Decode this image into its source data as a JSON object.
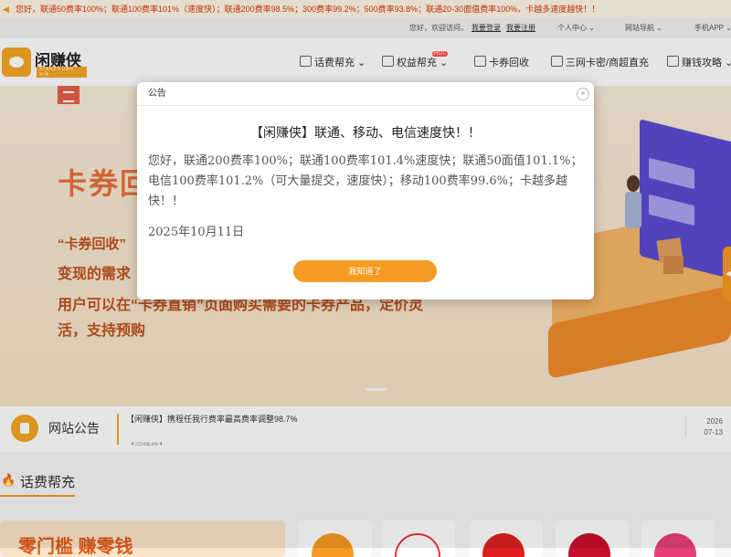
{
  "ticker": "您好，联通50费率100%；联通100费率101%（速度快）；联通200费率98.5%；300费率99.2%；500费率93.8%；联通20-30面值费率100%，卡越多速度越快！！",
  "utility": {
    "greeting": "您好，欢迎访问，",
    "login": "我要登录",
    "register": "我要注册",
    "personal_center": "个人中心",
    "site_nav": "网站导航",
    "mobile_app": "手机APP"
  },
  "logo": {
    "name": "闲赚侠",
    "pinyin": "XIANZHUAN XIA"
  },
  "nav": {
    "items": [
      {
        "label": "话费帮充",
        "icon": "phone-icon"
      },
      {
        "label": "权益帮充",
        "icon": "gift-icon"
      },
      {
        "label": "卡券回收",
        "icon": "tag-icon"
      },
      {
        "label": "三网卡密/商超直充",
        "icon": "bag-icon"
      },
      {
        "label": "赚钱攻略",
        "icon": "book-icon"
      }
    ],
    "hot_badge": "HOT"
  },
  "banner": {
    "title": "卡券回收",
    "lines": [
      "“卡券回收”",
      "变现的需求",
      "用户可以在“卡券直销”页面购买需要的卡券产品，定价灵",
      "活，支持预购"
    ]
  },
  "modal": {
    "header": "公告",
    "title": "【闲赚侠】联通、移动、电信速度快！！",
    "body": "您好，联通200费率100%；联通100费率101.4%速度快；联通50面值101.1%；电信100费率101.2%（可大量提交，速度快）；移动100费率99.6%；卡越多越快！！",
    "date": "2025年10月11日",
    "button": "我知道了"
  },
  "notice": {
    "label": "网站公告",
    "item": "【闲赚侠】携程任我行费率最高费率调整98.7%",
    "item2": "【闲赚侠】",
    "date_year": "2026",
    "date_md": "07-13"
  },
  "section": {
    "title": "话费帮充"
  },
  "promo": {
    "text": "零门槛 赚零钱"
  },
  "colors": {
    "accent": "#f59a23",
    "banner_text": "#e8723a"
  }
}
